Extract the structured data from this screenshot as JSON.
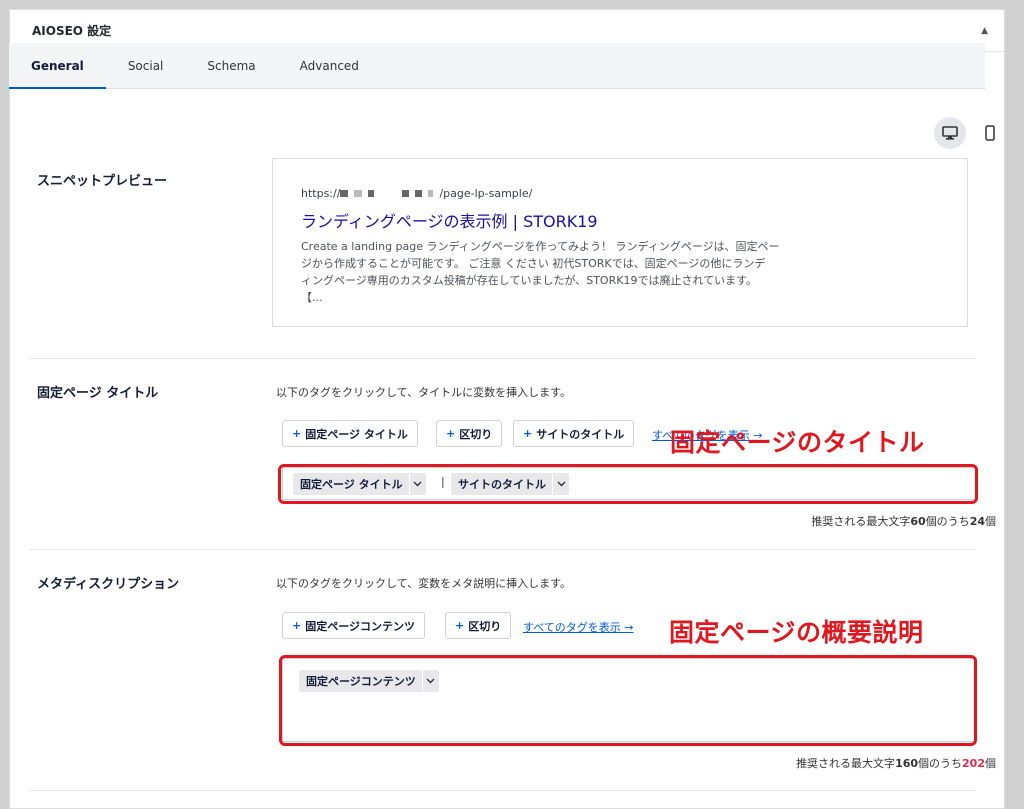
{
  "panel": {
    "title": "AIOSEO 設定"
  },
  "tabs": [
    {
      "label": "General"
    },
    {
      "label": "Social"
    },
    {
      "label": "Schema"
    },
    {
      "label": "Advanced"
    }
  ],
  "snippet": {
    "label": "スニペットプレビュー",
    "url_prefix": "https://",
    "url_suffix": "/page-lp-sample/",
    "title": "ランディングページの表示例 | STORK19",
    "description_lines": [
      "Create a landing page ランディングページを作ってみよう！ ランディングページは、固定ペー",
      "ジから作成することが可能です。 ご注意 ください 初代STORKでは、固定ページの他にランデ",
      "ィングページ専用のカスタム投稿が存在していましたが、STORK19では廃止されています。",
      "【..."
    ]
  },
  "title_section": {
    "label": "固定ページ タイトル",
    "instruction": "以下のタグをクリックして、タイトルに変数を挿入します。",
    "tag_buttons": [
      "固定ページ タイトル",
      "区切り",
      "サイトのタイトル"
    ],
    "show_all_link": "すべてのタグを表示 →",
    "chips": [
      "固定ページ タイトル",
      "サイトのタイトル"
    ],
    "separator": "|",
    "counter": {
      "prefix": "推奨される最大文字",
      "max": "60",
      "middle": "個のうち",
      "count": "24",
      "suffix": "個"
    },
    "annotation": "固定ページのタイトル"
  },
  "desc_section": {
    "label": "メタディスクリプション",
    "instruction": "以下のタグをクリックして、変数をメタ説明に挿入します。",
    "tag_buttons": [
      "固定ページコンテンツ",
      "区切り"
    ],
    "show_all_link": "すべてのタグを表示 →",
    "chips": [
      "固定ページコンテンツ"
    ],
    "counter": {
      "prefix": "推奨される最大文字",
      "max": "160",
      "middle": "個のうち",
      "count": "202",
      "suffix": "個"
    },
    "annotation": "固定ページの概要説明"
  },
  "colors": {
    "accent": "#005ae0",
    "annotation_red": "#e0171e",
    "counter_over": "#df2a4a",
    "snippet_title": "#1a0dab"
  },
  "icons": [
    "chevron-up-icon",
    "desktop-icon",
    "mobile-icon",
    "plus-icon",
    "chevron-down-icon"
  ]
}
